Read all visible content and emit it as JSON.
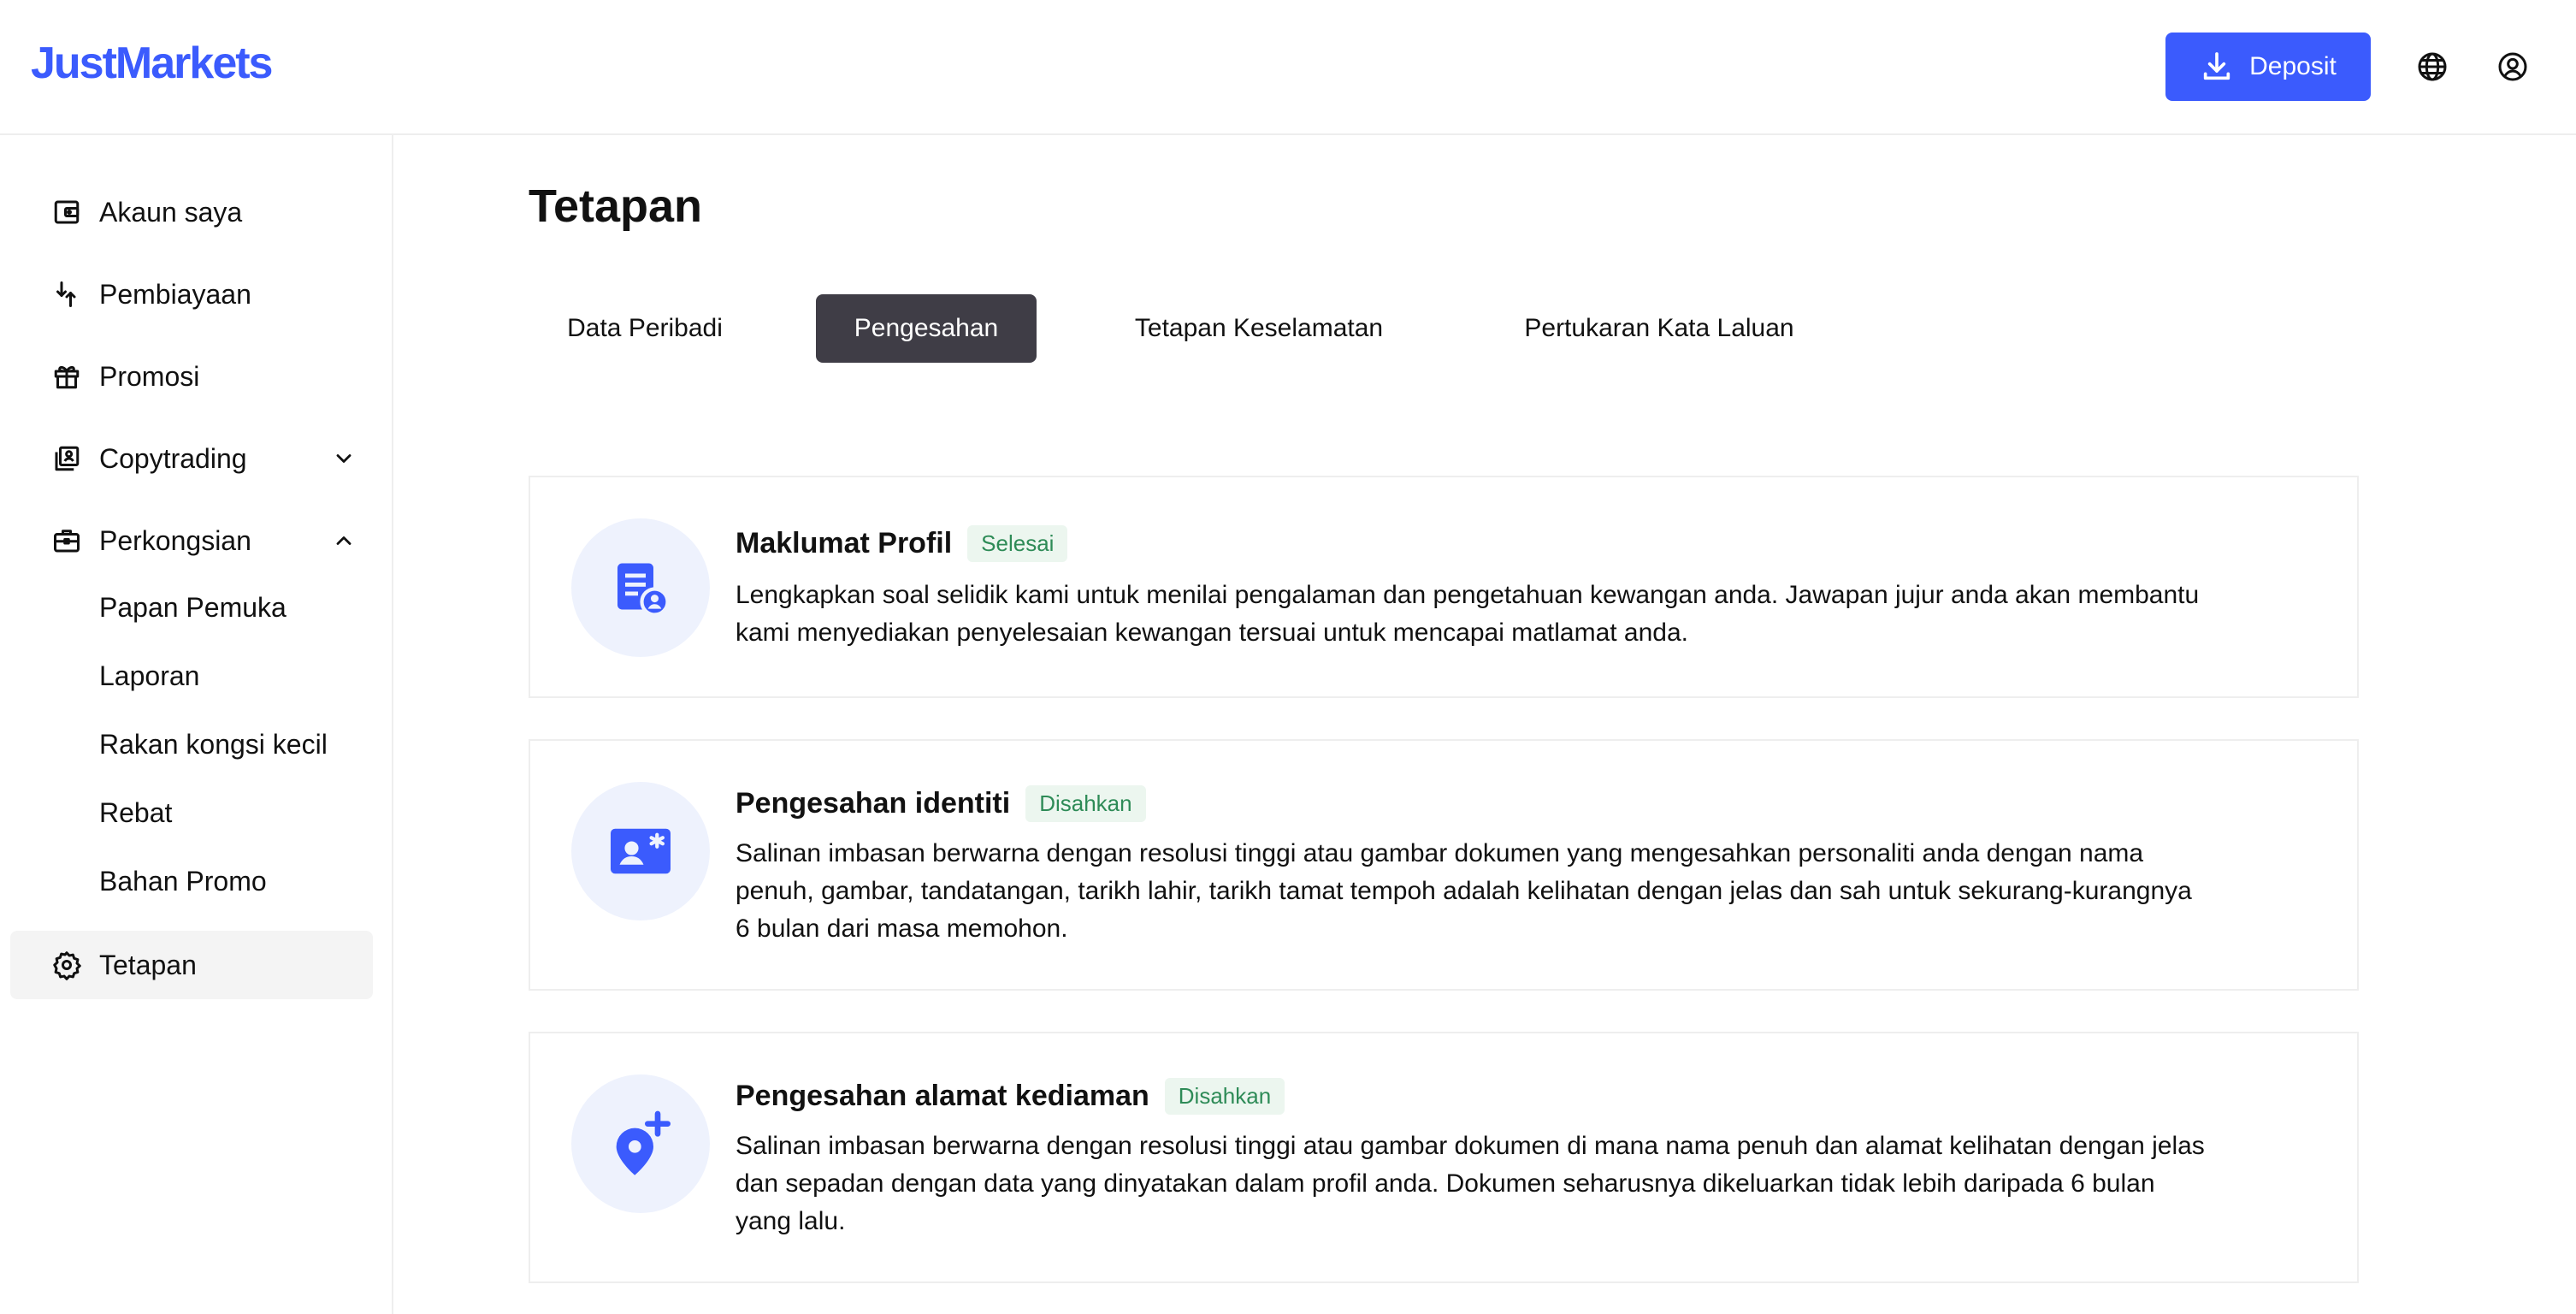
{
  "header": {
    "logo": "JustMarkets",
    "deposit_label": "Deposit",
    "icons": [
      "download-icon",
      "globe-icon",
      "user-circle-icon"
    ],
    "accent": "#3b5bfd"
  },
  "sidebar": {
    "items": [
      {
        "label": "Akaun saya",
        "icon": "wallet-icon"
      },
      {
        "label": "Pembiayaan",
        "icon": "transfer-arrows-icon"
      },
      {
        "label": "Promosi",
        "icon": "gift-icon"
      },
      {
        "label": "Copytrading",
        "icon": "copy-user-icon",
        "chevron": "down"
      },
      {
        "label": "Perkongsian",
        "icon": "briefcase-icon",
        "chevron": "up"
      },
      {
        "label": "Tetapan",
        "icon": "gear-icon",
        "active": true
      }
    ],
    "sub_items": [
      "Papan Pemuka",
      "Laporan",
      "Rakan kongsi kecil",
      "Rebat",
      "Bahan Promo"
    ]
  },
  "main": {
    "title": "Tetapan",
    "tabs": [
      {
        "label": "Data Peribadi"
      },
      {
        "label": "Pengesahan",
        "active": true
      },
      {
        "label": "Tetapan Keselamatan"
      },
      {
        "label": "Pertukaran Kata Laluan"
      }
    ],
    "cards": [
      {
        "title": "Maklumat Profil",
        "badge": "Selesai",
        "icon": "profile-document-icon",
        "description": "Lengkapkan soal selidik kami untuk menilai pengalaman dan pengetahuan kewangan anda. Jawapan jujur anda akan membantu kami menyediakan penyelesaian kewangan tersuai untuk mencapai matlamat anda."
      },
      {
        "title": "Pengesahan identiti",
        "badge": "Disahkan",
        "icon": "id-card-icon",
        "description": "Salinan imbasan berwarna dengan resolusi tinggi atau gambar dokumen yang mengesahkan personaliti anda dengan nama penuh, gambar, tandatangan, tarikh lahir, tarikh tamat tempoh adalah kelihatan dengan jelas dan sah untuk sekurang-kurangnya 6 bulan dari masa memohon."
      },
      {
        "title": "Pengesahan alamat kediaman",
        "badge": "Disahkan",
        "icon": "location-pin-plus-icon",
        "description": "Salinan imbasan berwarna dengan resolusi tinggi atau gambar dokumen di mana nama penuh dan alamat kelihatan dengan jelas dan sepadan dengan data yang dinyatakan dalam profil anda. Dokumen seharusnya dikeluarkan tidak lebih daripada 6 bulan yang lalu."
      }
    ]
  }
}
